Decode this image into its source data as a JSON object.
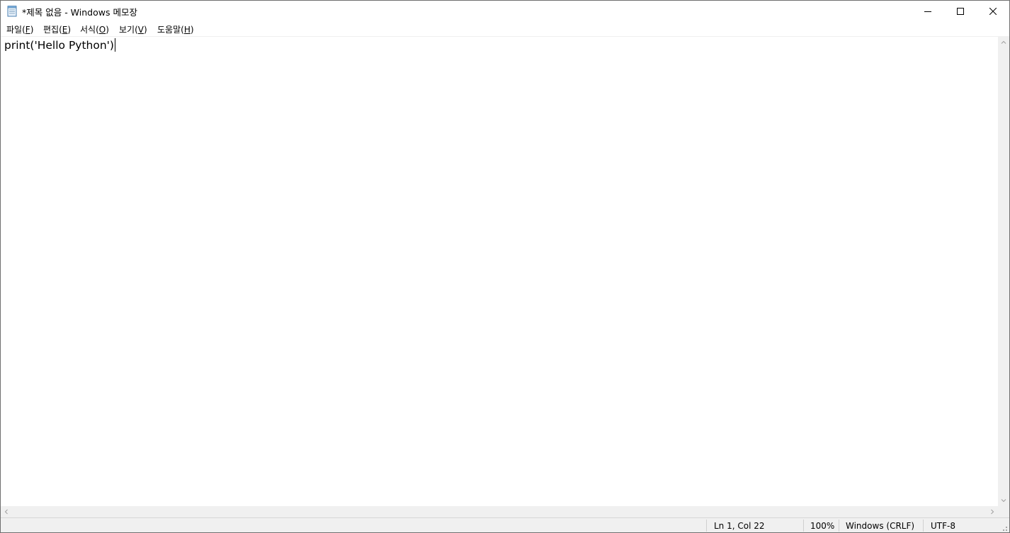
{
  "window": {
    "title": "*제목 없음 - Windows 메모장"
  },
  "menu": [
    {
      "label": "파일",
      "key": "F"
    },
    {
      "label": "편집",
      "key": "E"
    },
    {
      "label": "서식",
      "key": "O"
    },
    {
      "label": "보기",
      "key": "V"
    },
    {
      "label": "도움말",
      "key": "H"
    }
  ],
  "editor": {
    "content": "print('Hello Python')"
  },
  "status": {
    "position": "Ln 1, Col 22",
    "zoom": "100%",
    "line_ending": "Windows (CRLF)",
    "encoding": "UTF-8"
  },
  "icons": {
    "app": "notepad-icon",
    "minimize": "minimize-icon",
    "maximize": "maximize-icon",
    "close": "close-icon"
  }
}
